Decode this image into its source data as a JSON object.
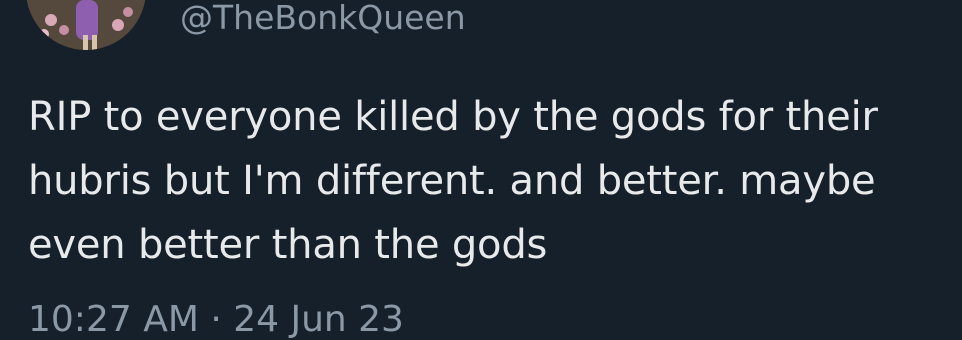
{
  "tweet": {
    "handle": "@TheBonkQueen",
    "text": "RIP to everyone killed by the gods for their\nhubris but I'm different. and better. maybe\neven better than the gods",
    "timestamp": "10:27 AM · 24 Jun 23"
  },
  "colors": {
    "background": "#15202b",
    "text": "#e7e9ea",
    "secondary": "#8b98a5"
  },
  "icons": {
    "avatar": "profile-photo"
  }
}
